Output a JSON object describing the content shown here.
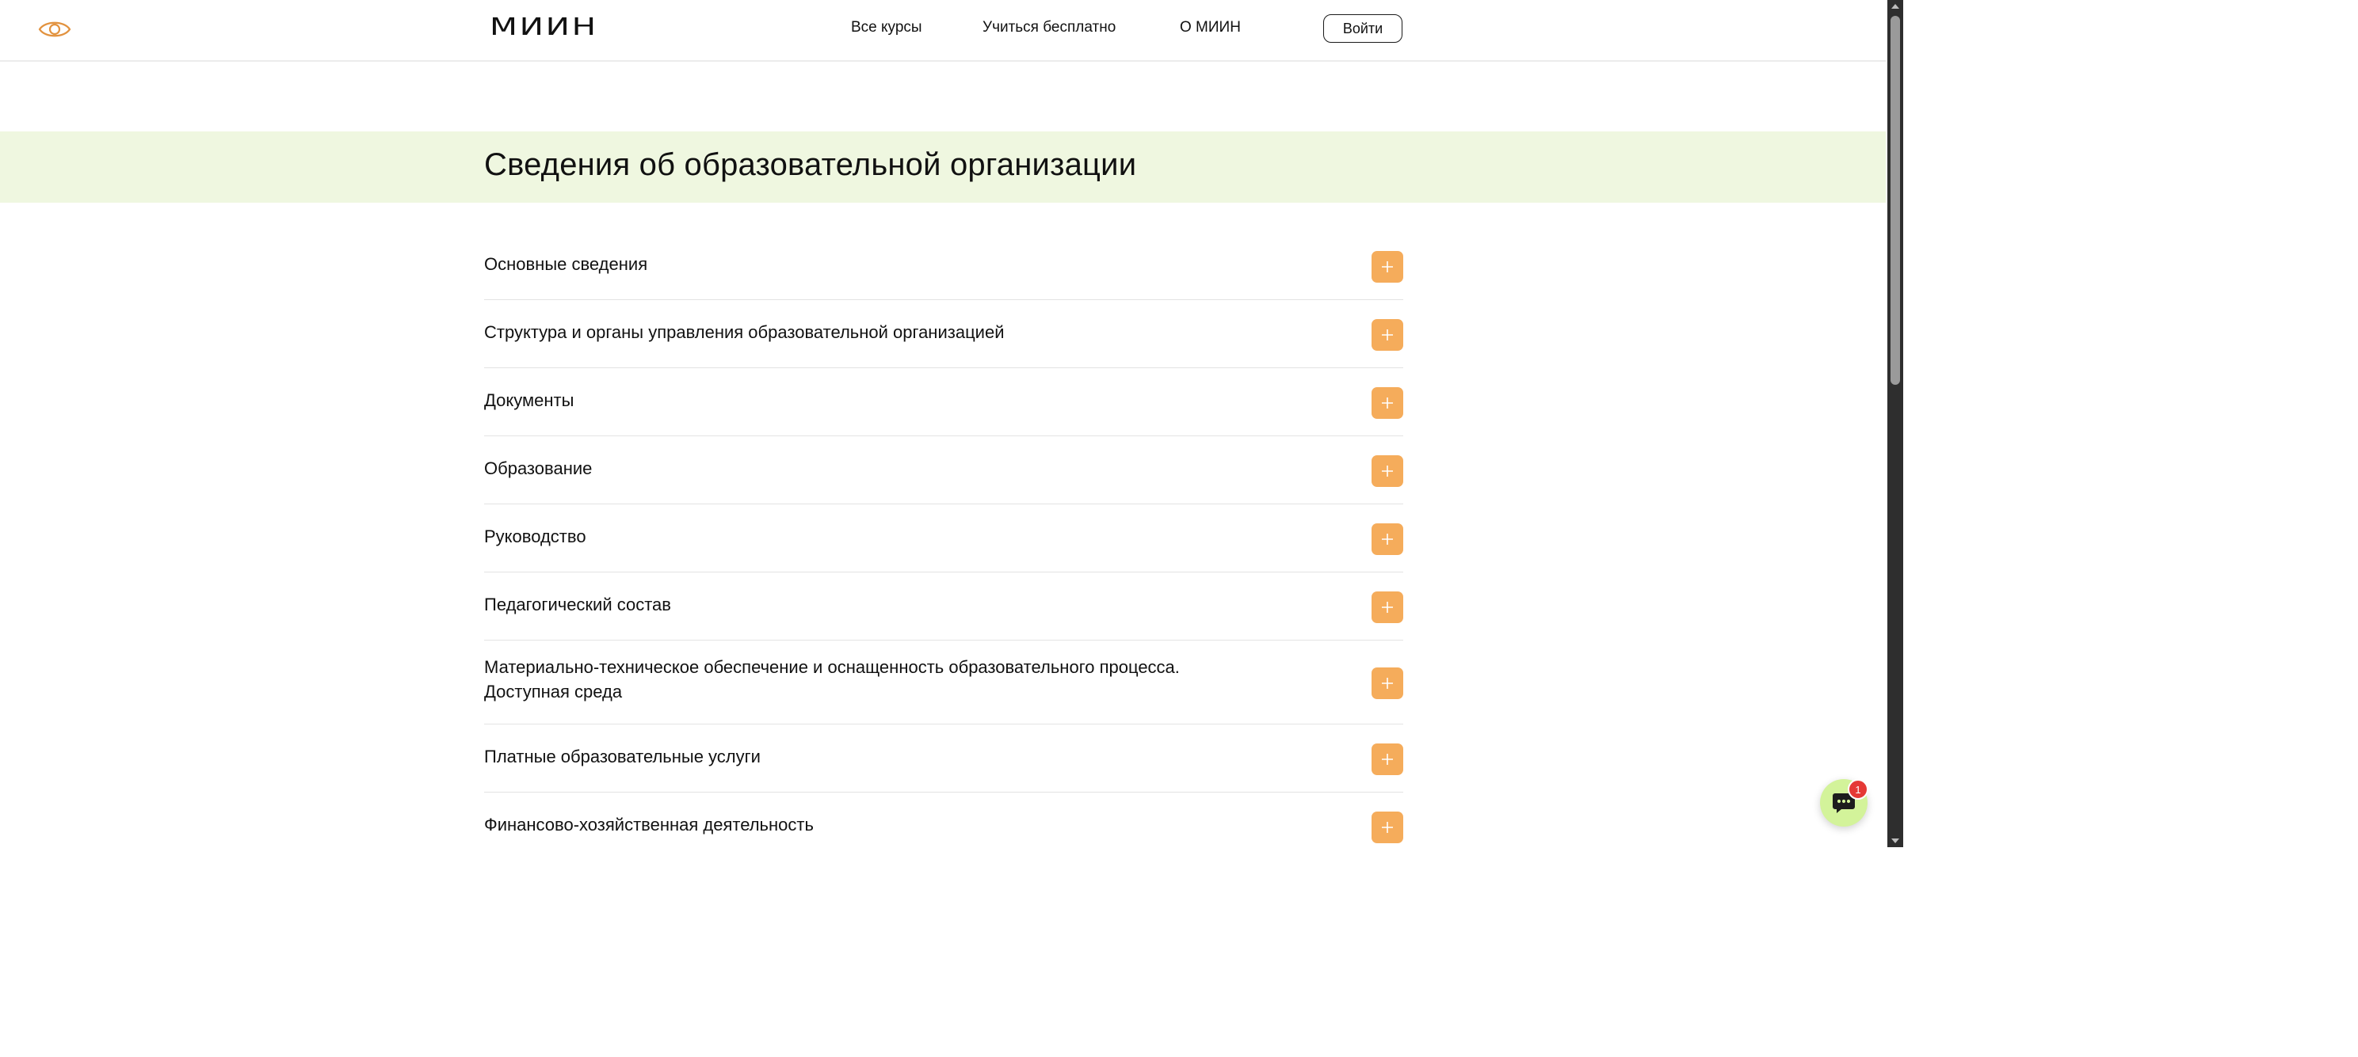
{
  "header": {
    "accessibility_icon": "eye-icon",
    "logo": "МИИН",
    "nav": [
      {
        "label": "Все курсы"
      },
      {
        "label": "Учиться бесплатно"
      },
      {
        "label": "О МИИН"
      }
    ],
    "login_label": "Войти"
  },
  "banner": {
    "title": "Сведения об образовательной организации"
  },
  "accordion": {
    "items": [
      {
        "label": "Основные сведения"
      },
      {
        "label": "Структура и органы управления образовательной организацией"
      },
      {
        "label": "Документы"
      },
      {
        "label": "Образование"
      },
      {
        "label": "Руководство"
      },
      {
        "label": "Педагогический состав"
      },
      {
        "label": "Материально-техническое обеспечение и оснащенность образовательного процесса. Доступная среда"
      },
      {
        "label": "Платные образовательные услуги"
      },
      {
        "label": "Финансово-хозяйственная деятельность"
      }
    ],
    "expand_icon": "plus-icon"
  },
  "chat": {
    "icon": "chat-icon",
    "badge_count": "1"
  },
  "colors": {
    "accent_orange": "#f5ac5b",
    "banner_bg": "#eff7e0",
    "chat_bg": "#d3f39a",
    "badge_red": "#e53935",
    "eye_orange": "#e2923e"
  }
}
